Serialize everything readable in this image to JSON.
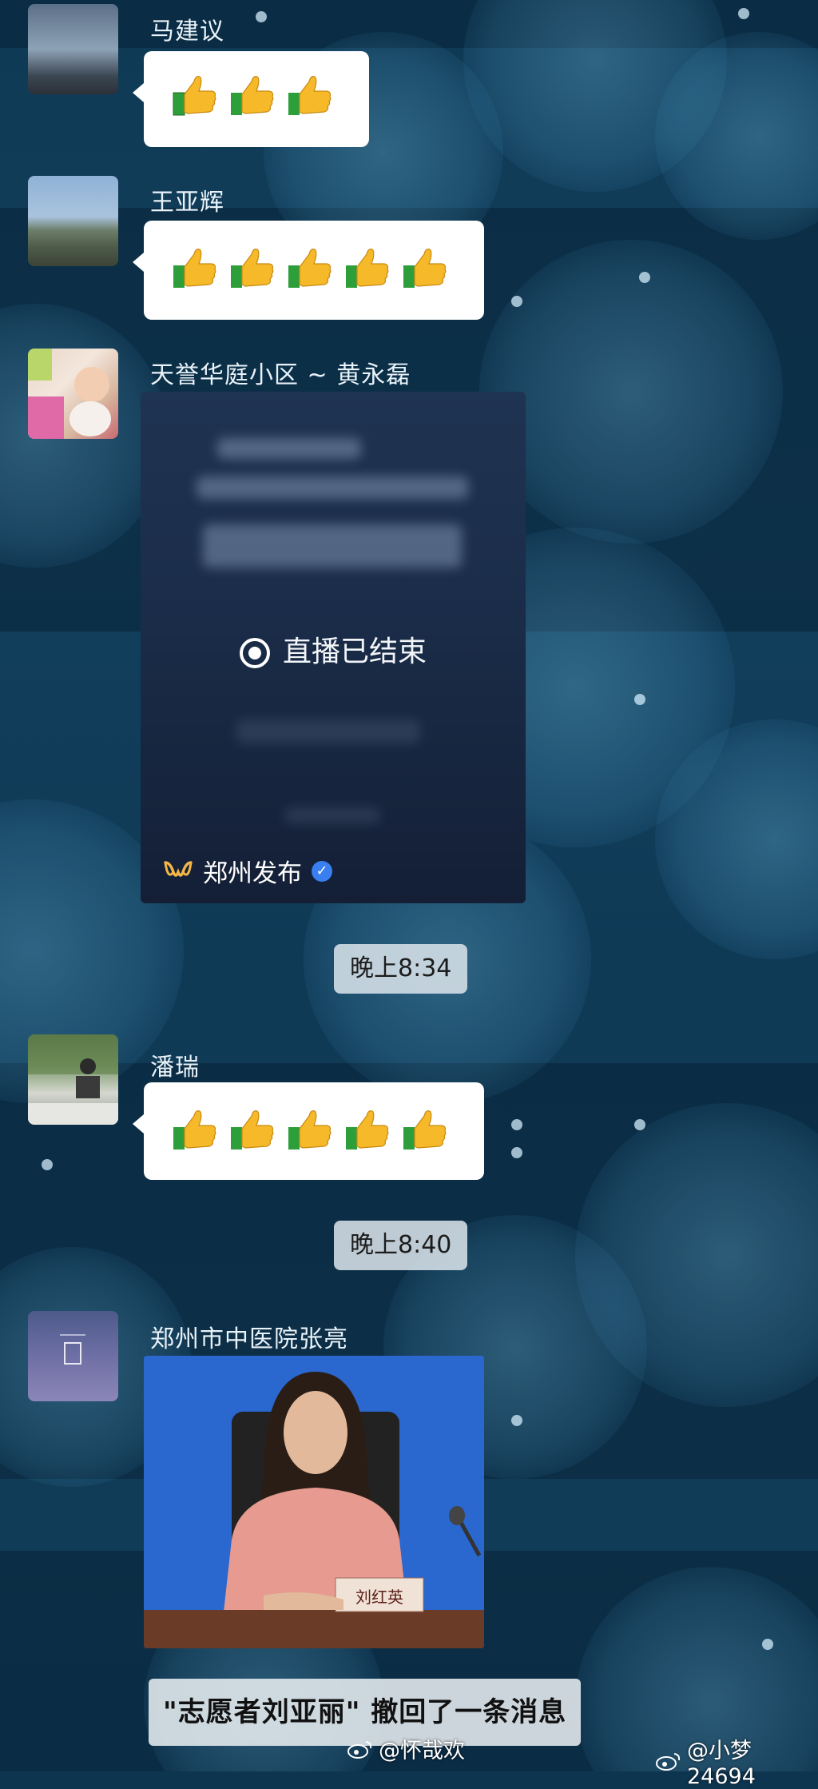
{
  "messages": [
    {
      "sender": "马建议",
      "content_type": "emoji",
      "emoji": "thumbs-up",
      "emoji_count": 3
    },
    {
      "sender": "王亚辉",
      "content_type": "emoji",
      "emoji": "thumbs-up",
      "emoji_count": 5
    },
    {
      "sender": "天誉华庭小区 ~ 黄永磊",
      "content_type": "live-share",
      "live_status": "直播已结束",
      "live_source": "郑州发布"
    },
    {
      "sender": "潘瑞",
      "content_type": "emoji",
      "emoji": "thumbs-up",
      "emoji_count": 5
    },
    {
      "sender": "郑州市中医院张亮",
      "content_type": "image",
      "nameplate": "刘红英"
    }
  ],
  "timestamps": [
    "晚上8:34",
    "晚上8:40"
  ],
  "recall_notice": "\"志愿者刘亚丽\" 撤回了一条消息",
  "watermarks": [
    "@怀哉欢",
    "@小梦24694"
  ],
  "colors": {
    "bubble": "#ffffff",
    "name_text": "#e8f2f8",
    "verified_badge": "#3a7ff0"
  }
}
